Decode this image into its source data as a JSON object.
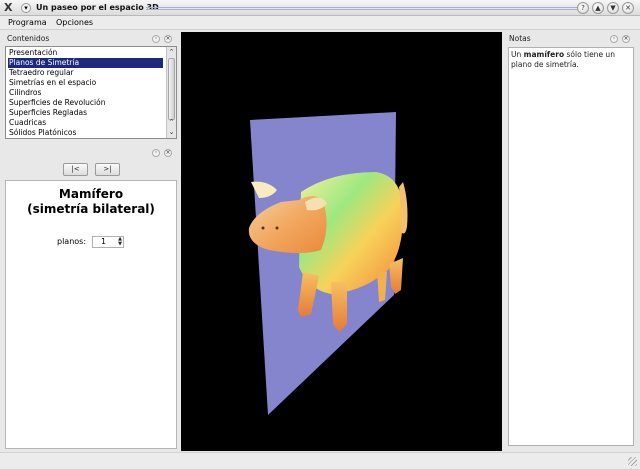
{
  "window": {
    "title": "Un paseo por el espacio 3D",
    "app_icon": "X",
    "menu_glyph": "▾",
    "controls": {
      "help": "?",
      "minimize": "▲",
      "restore": "▼",
      "close": "✕"
    }
  },
  "menubar": {
    "items": [
      "Programa",
      "Opciones"
    ]
  },
  "contents_dock": {
    "title": "Contenidos",
    "items": [
      "Presentación",
      "Planos de Simetría",
      "Tetraedro regular",
      "Simetrías en el espacio",
      "Cilindros",
      "Superficies de Revolución",
      "Superficies Regladas",
      "Cuadricas",
      "Sólidos Platónicos"
    ],
    "selected_index": 1
  },
  "dock_buttons": {
    "float": "◦",
    "close": "×"
  },
  "scroll": {
    "up": "⌃",
    "down": "⌄"
  },
  "nav": {
    "first": "|<",
    "last": ">|"
  },
  "info": {
    "heading_line1": "Mamífero",
    "heading_line2": "(simetría bilateral)",
    "planos_label": "planos:",
    "planos_value": "1",
    "spin_up": "▲",
    "spin_down": "▼"
  },
  "notes_dock": {
    "title": "Notas",
    "text_before": "Un ",
    "text_bold": "mamífero",
    "text_after": " sólo tiene un plano de simetría."
  },
  "colors": {
    "selection": "#1c2a7e",
    "viewport_bg": "#000000",
    "symmetry_plane": "#8c8cd8"
  }
}
